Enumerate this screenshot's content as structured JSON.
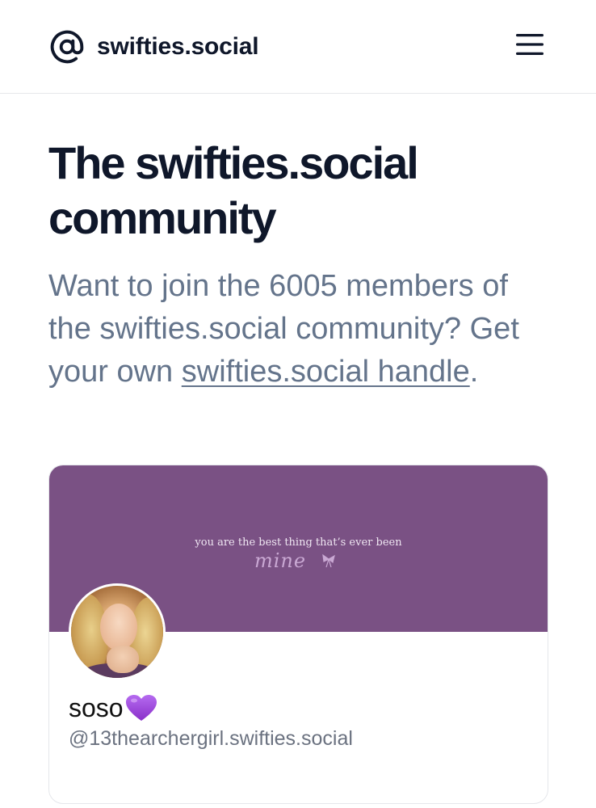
{
  "header": {
    "brand_icon": "at-sign-icon",
    "brand_name": "swifties.social",
    "menu_icon": "hamburger-menu-icon"
  },
  "main": {
    "title": "The swifties.social community",
    "intro_before": "Want to join the 6005 members of the swifties.social community? Get your own ",
    "intro_link": "swifties.social handle",
    "intro_after": "."
  },
  "member_card": {
    "banner_color": "#7a5184",
    "banner_quote": "you are the best thing that’s ever been",
    "banner_script": "mine",
    "name": "soso",
    "name_emoji": "purple-heart-icon",
    "handle": "@13thearchergirl.swifties.social"
  },
  "colors": {
    "heading": "#0f172a",
    "body_text": "#64748b",
    "border": "#e6e8eb",
    "purple_heart": "#9b3fd6"
  }
}
